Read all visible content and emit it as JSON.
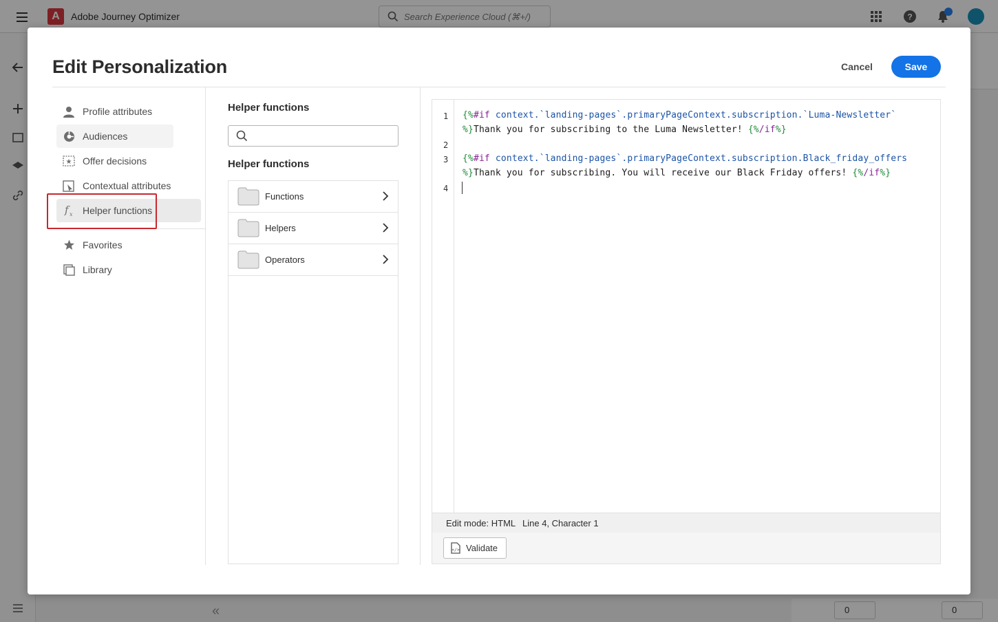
{
  "app": {
    "title": "Adobe Journey Optimizer",
    "logo_letter": "A",
    "search_placeholder": "Search Experience Cloud (⌘+/)"
  },
  "background": {
    "footer_values": [
      "0",
      "0"
    ]
  },
  "modal": {
    "title": "Edit Personalization",
    "cancel_label": "Cancel",
    "save_label": "Save"
  },
  "nav": {
    "items": [
      {
        "label": "Profile attributes",
        "icon": "person-icon"
      },
      {
        "label": "Audiences",
        "icon": "audiences-icon"
      },
      {
        "label": "Offer decisions",
        "icon": "offer-icon"
      },
      {
        "label": "Contextual attributes",
        "icon": "contextual-icon"
      },
      {
        "label": "Helper functions",
        "icon": "function-icon",
        "selected": true
      }
    ],
    "secondary": [
      {
        "label": "Favorites",
        "icon": "star-icon"
      },
      {
        "label": "Library",
        "icon": "library-icon"
      }
    ],
    "collapse_glyph": "«"
  },
  "helper_panel": {
    "heading": "Helper functions",
    "search_value": "",
    "list_heading": "Helper functions",
    "rows": [
      {
        "label": "Functions"
      },
      {
        "label": "Helpers"
      },
      {
        "label": "Operators"
      }
    ]
  },
  "editor": {
    "line_numbers": [
      "1",
      "2",
      "3",
      "4"
    ],
    "lines": [
      "{%#if context.`landing-pages`.primaryPageContext.subscription.`Luma-Newsletter`",
      "%}Thank you for subscribing to the Luma Newsletter! {%/if%}",
      "",
      "{%#if context.`landing-pages`.primaryPageContext.subscription.Black_friday_offers",
      "%}Thank you for subscribing. You will receive our Black Friday offers! {%/if%}",
      ""
    ],
    "status_mode": "Edit mode: HTML",
    "status_position": "Line 4, Character 1",
    "validate_label": "Validate"
  },
  "colors": {
    "accent": "#1473e6",
    "highlight": "#c8272f",
    "brand": "#d7373f"
  }
}
